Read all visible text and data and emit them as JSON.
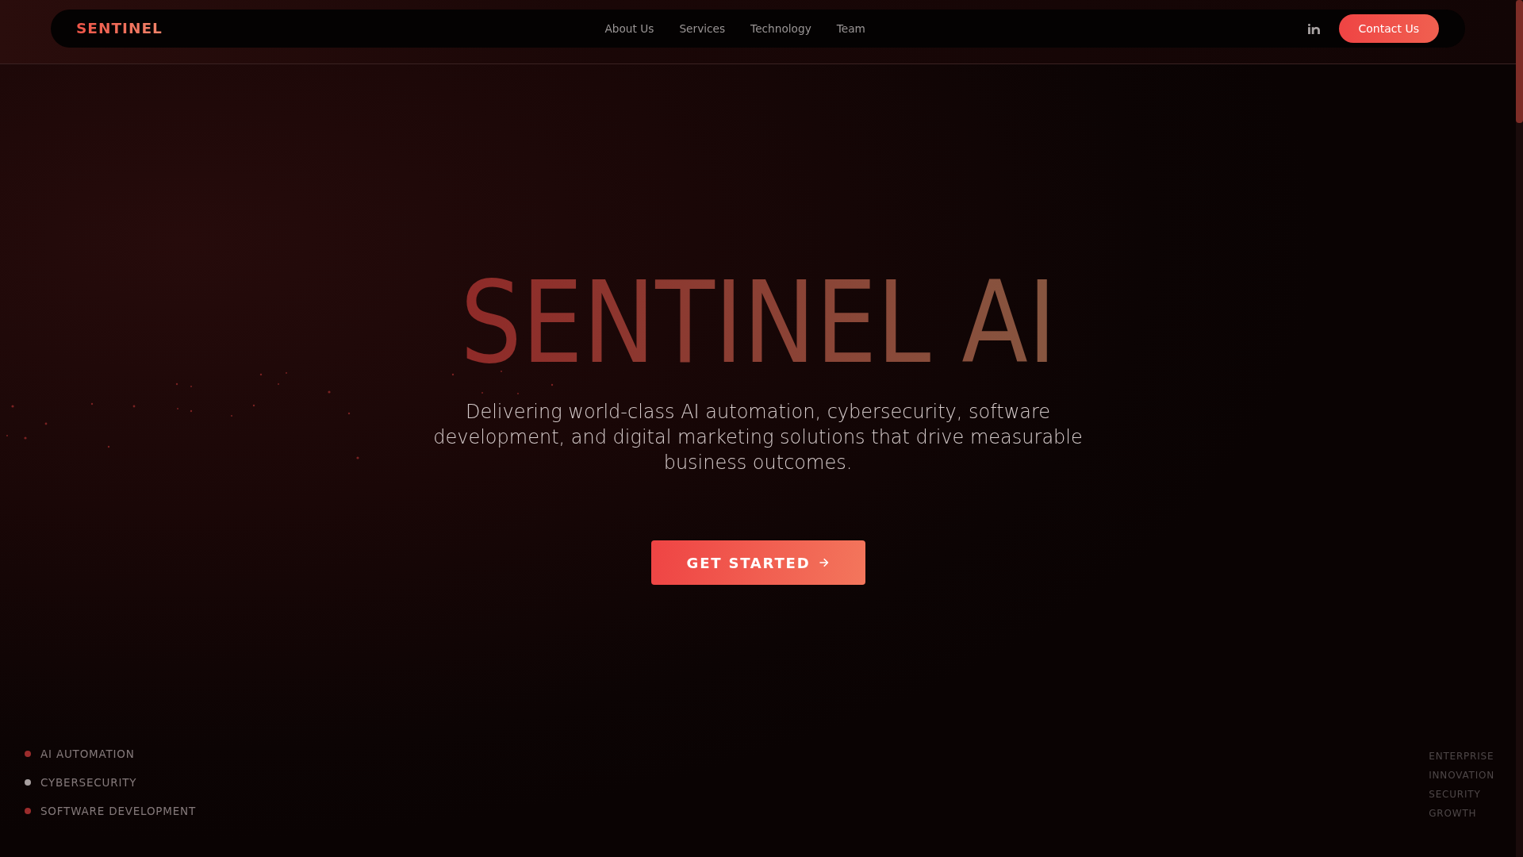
{
  "header": {
    "logo": "SENTINEL",
    "nav_links": [
      {
        "label": "About Us"
      },
      {
        "label": "Services"
      },
      {
        "label": "Technology"
      },
      {
        "label": "Team"
      }
    ],
    "contact_button": "Contact Us"
  },
  "hero": {
    "title": "SENTINEL AI",
    "subtitle": "Delivering world-class AI automation, cybersecurity, software development, and digital marketing solutions that drive measurable business outcomes.",
    "cta_button": "GET STARTED"
  },
  "services": [
    {
      "label": "AI AUTOMATION",
      "color": "#9b2c2c"
    },
    {
      "label": "CYBERSECURITY",
      "color": "#a8a0a0"
    },
    {
      "label": "SOFTWARE DEVELOPMENT",
      "color": "#9b2c2c"
    }
  ],
  "keywords": [
    "ENTERPRISE",
    "INNOVATION",
    "SECURITY",
    "GROWTH"
  ]
}
